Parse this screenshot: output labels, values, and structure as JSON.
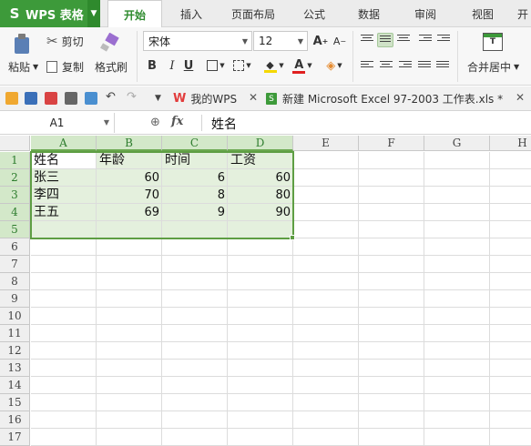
{
  "app": {
    "name": "WPS 表格",
    "logo_letter": "S"
  },
  "menu": {
    "tabs": [
      "开始",
      "插入",
      "页面布局",
      "公式",
      "数据",
      "审阅",
      "视图",
      "开"
    ],
    "active": "开始"
  },
  "ribbon": {
    "paste_label": "粘贴",
    "cut_label": "剪切",
    "copy_label": "复制",
    "format_painter_label": "格式刷",
    "font_name": "宋体",
    "font_size": "12",
    "merge_label": "合并居中",
    "bold": "B",
    "italic": "I",
    "underline": "U",
    "font_grow": "A",
    "font_shrink": "A",
    "font_color_letter": "A",
    "colors": {
      "fill_color": "#f5d800",
      "font_color": "#e02020",
      "accent_green": "#3d9a3a"
    }
  },
  "doc_tabs": {
    "tab1_label": "我的WPS",
    "tab2_label": "新建 Microsoft Excel 97-2003 工作表.xls *"
  },
  "formula_bar": {
    "cell_ref": "A1",
    "fx_label": "fx",
    "content": "姓名"
  },
  "sheet": {
    "columns": [
      "A",
      "B",
      "C",
      "D",
      "E",
      "F",
      "G",
      "H"
    ],
    "selected_columns": [
      "A",
      "B",
      "C",
      "D"
    ],
    "rows": [
      "1",
      "2",
      "3",
      "4",
      "5",
      "6",
      "7",
      "8",
      "9",
      "10",
      "11",
      "12",
      "13",
      "14",
      "15",
      "16",
      "17"
    ],
    "selected_rows": [
      "1",
      "2",
      "3",
      "4",
      "5"
    ],
    "selection_range": "A1:D5",
    "headers": [
      "姓名",
      "年龄",
      "时间",
      "工资"
    ],
    "data": [
      [
        "张三",
        "60",
        "6",
        "60"
      ],
      [
        "李四",
        "70",
        "8",
        "80"
      ],
      [
        "王五",
        "69",
        "9",
        "90"
      ]
    ]
  }
}
